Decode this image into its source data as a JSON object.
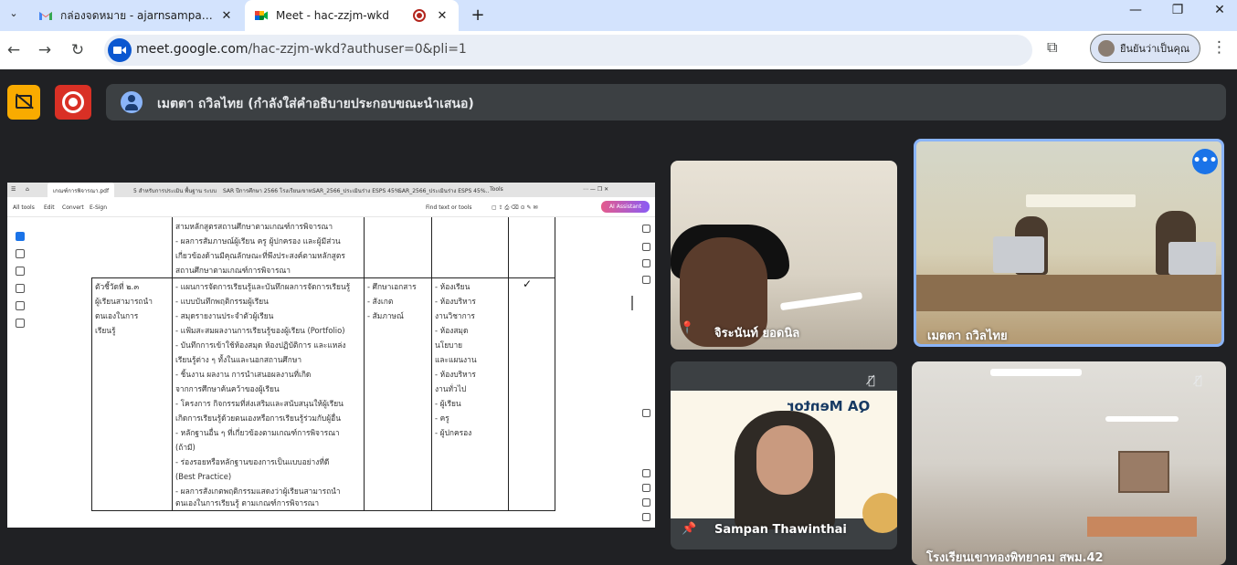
{
  "browser": {
    "tabs": [
      {
        "title": "กล่องจดหมาย - ajarnsampan@gmail.com",
        "icon": "gmail-icon",
        "active": false
      },
      {
        "title": "Meet - hac-zzjm-wkd",
        "icon": "meet-icon",
        "active": true
      }
    ],
    "url_host": "meet.google.com",
    "url_path": "/hac-zzjm-wkd?authuser=0&pli=1",
    "profile_label": "ยืนยันว่าเป็นคุณ",
    "accent": "#0b57d0"
  },
  "meet": {
    "presenting_banner": "เมตตา ถวิลไทย (กำลังใส่คำอธิบายประกอบขณะนำเสนอ)",
    "captions_button_color": "#f9ab00",
    "recording_button_color": "#d93025",
    "participants": [
      {
        "name": "จิระนันท์ ยอดนิล",
        "pinned": true
      },
      {
        "name": "เมตตา ถวิลไทย",
        "active_speaker": true
      },
      {
        "name": "Sampan Thawinthai",
        "pinned": true,
        "muted": true
      },
      {
        "name": "โรงเรียนเขาทองพิทยาคม สพม.42",
        "muted": true
      }
    ],
    "tile3_slide_title": "QA Mentor"
  },
  "shared_screen": {
    "tabs": [
      "เกณฑ์การพิจารณา.pdf",
      "5 สำหรับการประเมิน พื้นฐาน ระบบ",
      "SAR ปีการศึกษา 2566 โรงเรียนเขาท..",
      "SAR_2566_ประเมินร่าง ESPS 45%..",
      "SAR_2566_ประเมินร่าง ESPS 45%..",
      "Tools"
    ],
    "toolbar": [
      "All tools",
      "Edit",
      "Convert",
      "E-Sign"
    ],
    "find_label": "Find text or tools",
    "ai_button": "AI Assistant",
    "table": {
      "top_lines": [
        "สามหลักสูตรสถานศึกษาตามเกณฑ์การพิจารณา",
        "- ผลการสัมภาษณ์ผู้เรียน ครู ผู้ปกครอง และผู้มีส่วน",
        "เกี่ยวข้องด้านมีคุณลักษณะที่พึงประสงค์ตามหลักสูตร",
        "สถานศึกษาตามเกณฑ์การพิจารณา"
      ],
      "indicator_lines": [
        "ตัวชี้วัดที่ ๒.๓",
        "ผู้เรียนสามารถนำ",
        "ตนเองในการ",
        "เรียนรู้"
      ],
      "evidence_lines": [
        "- แผนการจัดการเรียนรู้และบันทึกผลการจัดการเรียนรู้",
        "- แบบบันทึกพฤติกรรมผู้เรียน",
        "- สมุดรายงานประจำตัวผู้เรียน",
        "- แฟ้มสะสมผลงานการเรียนรู้ของผู้เรียน (Portfolio)",
        "- บันทึกการเข้าใช้ห้องสมุด ห้องปฏิบัติการ และแหล่ง",
        "เรียนรู้ต่าง ๆ ทั้งในและนอกสถานศึกษา",
        "- ชิ้นงาน ผลงาน การนำเสนอผลงานที่เกิด",
        "จากการศึกษาค้นคว้าของผู้เรียน",
        "- โครงการ กิจกรรมที่ส่งเสริมและสนับสนุนให้ผู้เรียน",
        "เกิดการเรียนรู้ด้วยตนเองหรือการเรียนรู้ร่วมกับผู้อื่น",
        "- หลักฐานอื่น ๆ ที่เกี่ยวข้องตามเกณฑ์การพิจารณา",
        "(ถ้ามี)",
        "- ร่องรอยหรือหลักฐานของการเป็นแบบอย่างที่ดี",
        "(Best Practice)",
        "- ผลการสังเกตพฤติกรรมแสดงว่าผู้เรียนสามารถนำ",
        "ตนเองในการเรียนรู้ ตามเกณฑ์การพิจารณา"
      ],
      "method_lines": [
        "- ศึกษาเอกสาร",
        "- สังเกต",
        "- สัมภาษณ์"
      ],
      "source_lines": [
        "- ห้องเรียน",
        "- ห้องบริหาร",
        "งานวิชาการ",
        "- ห้องสมุด",
        "นโยบาย",
        "และแผนงาน",
        "- ห้องบริหาร",
        "งานทั่วไป",
        "- ผู้เรียน",
        "- ครู",
        "- ผู้ปกครอง"
      ],
      "check_mark": "✓"
    }
  }
}
